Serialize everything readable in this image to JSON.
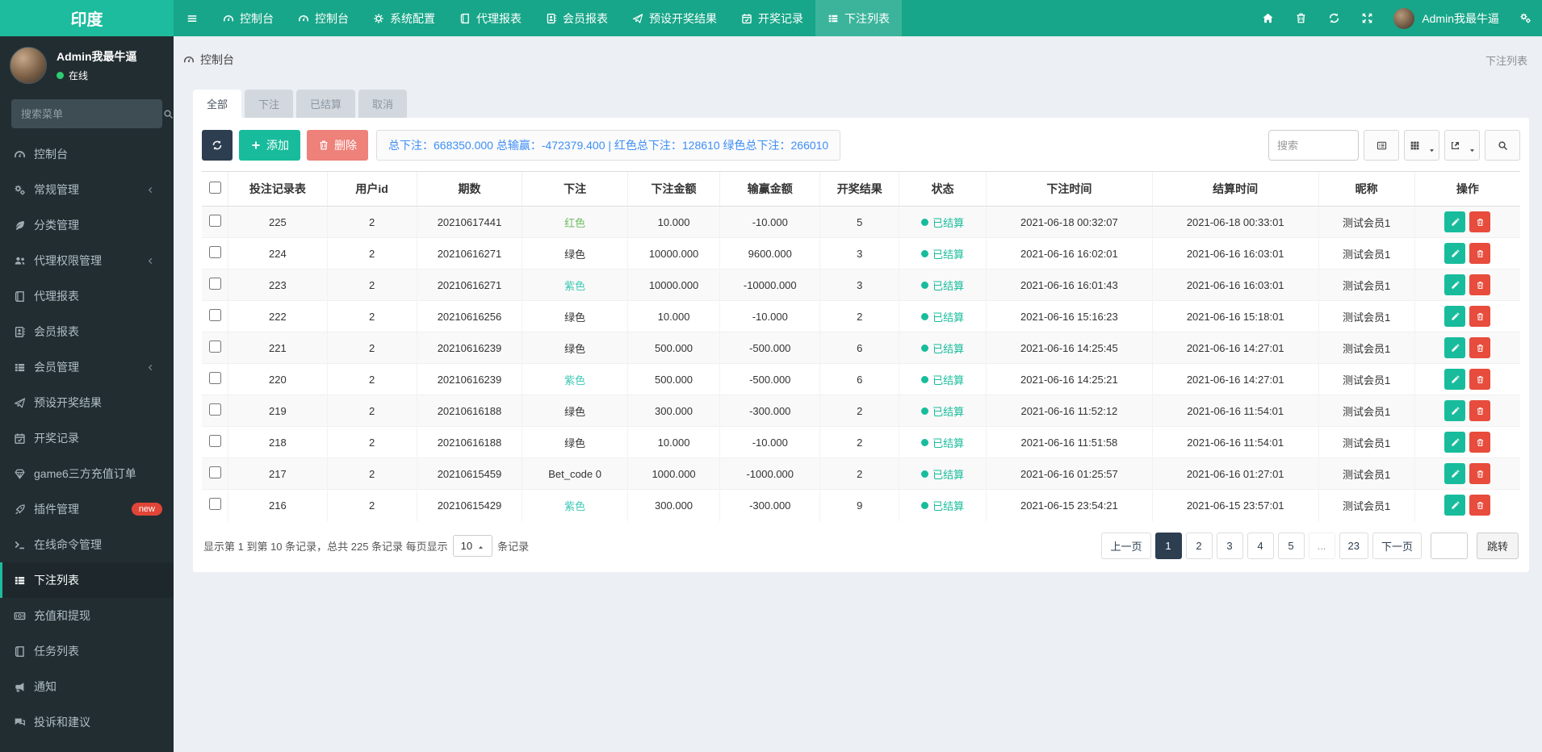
{
  "colors": {
    "brand_teal": "#1dbc9e",
    "navbar_teal": "#17a689",
    "sidebar_dark": "#222d32",
    "accent_green": "#18bc9c",
    "dark_navy": "#2c3e50",
    "danger_red": "#e74c3c",
    "soft_red": "#ee8179",
    "stats_blue": "#3e8ef7",
    "badge_red": "#e04537"
  },
  "navbar": {
    "brand": "印度",
    "toggle_icon": "bars",
    "items": [
      {
        "label": "控制台",
        "icon": "gauge"
      },
      {
        "label": "控制台",
        "icon": "gauge"
      },
      {
        "label": "系统配置",
        "icon": "gear"
      },
      {
        "label": "代理报表",
        "icon": "book"
      },
      {
        "label": "会员报表",
        "icon": "address-book"
      },
      {
        "label": "预设开奖结果",
        "icon": "send"
      },
      {
        "label": "开奖记录",
        "icon": "calendar-check"
      },
      {
        "label": "下注列表",
        "icon": "th-list",
        "active": true
      }
    ],
    "right_icons": [
      "home",
      "trash",
      "refresh",
      "expand"
    ],
    "user": {
      "name": "Admin我最牛逼"
    },
    "settings_icon": "gears"
  },
  "sidebar": {
    "user": {
      "name": "Admin我最牛逼",
      "status": "在线"
    },
    "search_placeholder": "搜索菜单",
    "items": [
      {
        "label": "控制台",
        "icon": "gauge"
      },
      {
        "label": "常规管理",
        "icon": "gears",
        "chevron": true
      },
      {
        "label": "分类管理",
        "icon": "leaf"
      },
      {
        "label": "代理权限管理",
        "icon": "users",
        "chevron": true
      },
      {
        "label": "代理报表",
        "icon": "book"
      },
      {
        "label": "会员报表",
        "icon": "address-book"
      },
      {
        "label": "会员管理",
        "icon": "th-list",
        "chevron": true
      },
      {
        "label": "预设开奖结果",
        "icon": "send"
      },
      {
        "label": "开奖记录",
        "icon": "calendar-check"
      },
      {
        "label": "game6三方充值订单",
        "icon": "gem"
      },
      {
        "label": "插件管理",
        "icon": "rocket",
        "badge": "new"
      },
      {
        "label": "在线命令管理",
        "icon": "terminal"
      },
      {
        "label": "下注列表",
        "icon": "th-list",
        "active": true
      },
      {
        "label": "充值和提现",
        "icon": "money"
      },
      {
        "label": "任务列表",
        "icon": "book"
      },
      {
        "label": "通知",
        "icon": "bullhorn"
      },
      {
        "label": "投诉和建议",
        "icon": "comments"
      }
    ]
  },
  "breadcrumb": {
    "left": "控制台",
    "left_icon": "gauge",
    "right": "下注列表"
  },
  "tabs": [
    {
      "label": "全部",
      "active": true
    },
    {
      "label": "下注"
    },
    {
      "label": "已结算"
    },
    {
      "label": "取消"
    }
  ],
  "toolbar": {
    "refresh_icon": "refresh",
    "add_label": "添加",
    "delete_label": "删除",
    "stats": "总下注：668350.000 总输赢：-472379.400 | 红色总下注：128610 绿色总下注：266010",
    "search_placeholder": "搜索",
    "view_buttons": [
      "list-alt",
      "th",
      "export"
    ],
    "search_button_icon": "search"
  },
  "table": {
    "columns": [
      "投注记录表",
      "用户id",
      "期数",
      "下注",
      "下注金额",
      "输赢金额",
      "开奖结果",
      "状态",
      "下注时间",
      "结算时间",
      "昵称",
      "操作"
    ],
    "rows": [
      {
        "record_id": "225",
        "user_id": "2",
        "issue": "20210617441",
        "bet": "红色",
        "bet_class": "red",
        "amount": "10.000",
        "win_lose": "-10.000",
        "result": "5",
        "status": "已结算",
        "bet_time": "2021-06-18 00:32:07",
        "settle_time": "2021-06-18 00:33:01",
        "nickname": "测试会员1"
      },
      {
        "record_id": "224",
        "user_id": "2",
        "issue": "20210616271",
        "bet": "绿色",
        "bet_class": "green",
        "amount": "10000.000",
        "win_lose": "9600.000",
        "result": "3",
        "status": "已结算",
        "bet_time": "2021-06-16 16:02:01",
        "settle_time": "2021-06-16 16:03:01",
        "nickname": "测试会员1"
      },
      {
        "record_id": "223",
        "user_id": "2",
        "issue": "20210616271",
        "bet": "紫色",
        "bet_class": "purple",
        "amount": "10000.000",
        "win_lose": "-10000.000",
        "result": "3",
        "status": "已结算",
        "bet_time": "2021-06-16 16:01:43",
        "settle_time": "2021-06-16 16:03:01",
        "nickname": "测试会员1"
      },
      {
        "record_id": "222",
        "user_id": "2",
        "issue": "20210616256",
        "bet": "绿色",
        "bet_class": "green",
        "amount": "10.000",
        "win_lose": "-10.000",
        "result": "2",
        "status": "已结算",
        "bet_time": "2021-06-16 15:16:23",
        "settle_time": "2021-06-16 15:18:01",
        "nickname": "测试会员1"
      },
      {
        "record_id": "221",
        "user_id": "2",
        "issue": "20210616239",
        "bet": "绿色",
        "bet_class": "green",
        "amount": "500.000",
        "win_lose": "-500.000",
        "result": "6",
        "status": "已结算",
        "bet_time": "2021-06-16 14:25:45",
        "settle_time": "2021-06-16 14:27:01",
        "nickname": "测试会员1"
      },
      {
        "record_id": "220",
        "user_id": "2",
        "issue": "20210616239",
        "bet": "紫色",
        "bet_class": "purple",
        "amount": "500.000",
        "win_lose": "-500.000",
        "result": "6",
        "status": "已结算",
        "bet_time": "2021-06-16 14:25:21",
        "settle_time": "2021-06-16 14:27:01",
        "nickname": "测试会员1"
      },
      {
        "record_id": "219",
        "user_id": "2",
        "issue": "20210616188",
        "bet": "绿色",
        "bet_class": "green",
        "amount": "300.000",
        "win_lose": "-300.000",
        "result": "2",
        "status": "已结算",
        "bet_time": "2021-06-16 11:52:12",
        "settle_time": "2021-06-16 11:54:01",
        "nickname": "测试会员1"
      },
      {
        "record_id": "218",
        "user_id": "2",
        "issue": "20210616188",
        "bet": "绿色",
        "bet_class": "green",
        "amount": "10.000",
        "win_lose": "-10.000",
        "result": "2",
        "status": "已结算",
        "bet_time": "2021-06-16 11:51:58",
        "settle_time": "2021-06-16 11:54:01",
        "nickname": "测试会员1"
      },
      {
        "record_id": "217",
        "user_id": "2",
        "issue": "20210615459",
        "bet": "Bet_code 0",
        "bet_class": "code",
        "amount": "1000.000",
        "win_lose": "-1000.000",
        "result": "2",
        "status": "已结算",
        "bet_time": "2021-06-16 01:25:57",
        "settle_time": "2021-06-16 01:27:01",
        "nickname": "测试会员1"
      },
      {
        "record_id": "216",
        "user_id": "2",
        "issue": "20210615429",
        "bet": "紫色",
        "bet_class": "purple",
        "amount": "300.000",
        "win_lose": "-300.000",
        "result": "9",
        "status": "已结算",
        "bet_time": "2021-06-15 23:54:21",
        "settle_time": "2021-06-15 23:57:01",
        "nickname": "测试会员1"
      }
    ]
  },
  "footer": {
    "summary_prefix": "显示第 1 到第 10 条记录，总共 225 条记录 每页显示",
    "page_size": "10",
    "summary_suffix": "条记录",
    "jump_label": "跳转"
  },
  "pagination": {
    "prev": "上一页",
    "next": "下一页",
    "pages": [
      "1",
      "2",
      "3",
      "4",
      "5",
      "...",
      "23"
    ],
    "active": "1"
  }
}
